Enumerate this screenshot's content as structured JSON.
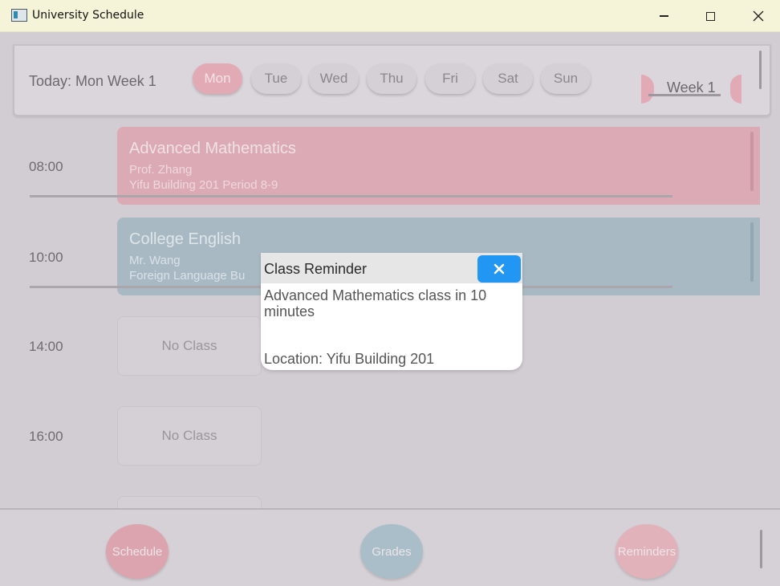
{
  "window": {
    "title": "University Schedule"
  },
  "header": {
    "today_label": "Today: Mon Week 1",
    "days": [
      "Mon",
      "Tue",
      "Wed",
      "Thu",
      "Fri",
      "Sat",
      "Sun"
    ],
    "active_day": "Mon",
    "week_label": "Week 1"
  },
  "schedule": {
    "slots": [
      {
        "time": "08:00",
        "course": "Advanced Mathematics",
        "teacher": "Prof. Zhang",
        "location": "Yifu Building 201 Period 8-9",
        "color": "#dcaab4"
      },
      {
        "time": "10:00",
        "course": "College English",
        "teacher": "Mr. Wang",
        "location": "Foreign Language Bu",
        "color": "#a9b9c4"
      },
      {
        "time": "14:00",
        "empty_label": "No Class"
      },
      {
        "time": "16:00",
        "empty_label": "No Class"
      }
    ]
  },
  "nav": {
    "schedule": "Schedule",
    "grades": "Grades",
    "reminders": "Reminders"
  },
  "dialog": {
    "title": "Class Reminder",
    "message": "Advanced Mathematics class in 10 minutes",
    "location": "Location: Yifu Building 201",
    "close_color": "#2196f3"
  }
}
